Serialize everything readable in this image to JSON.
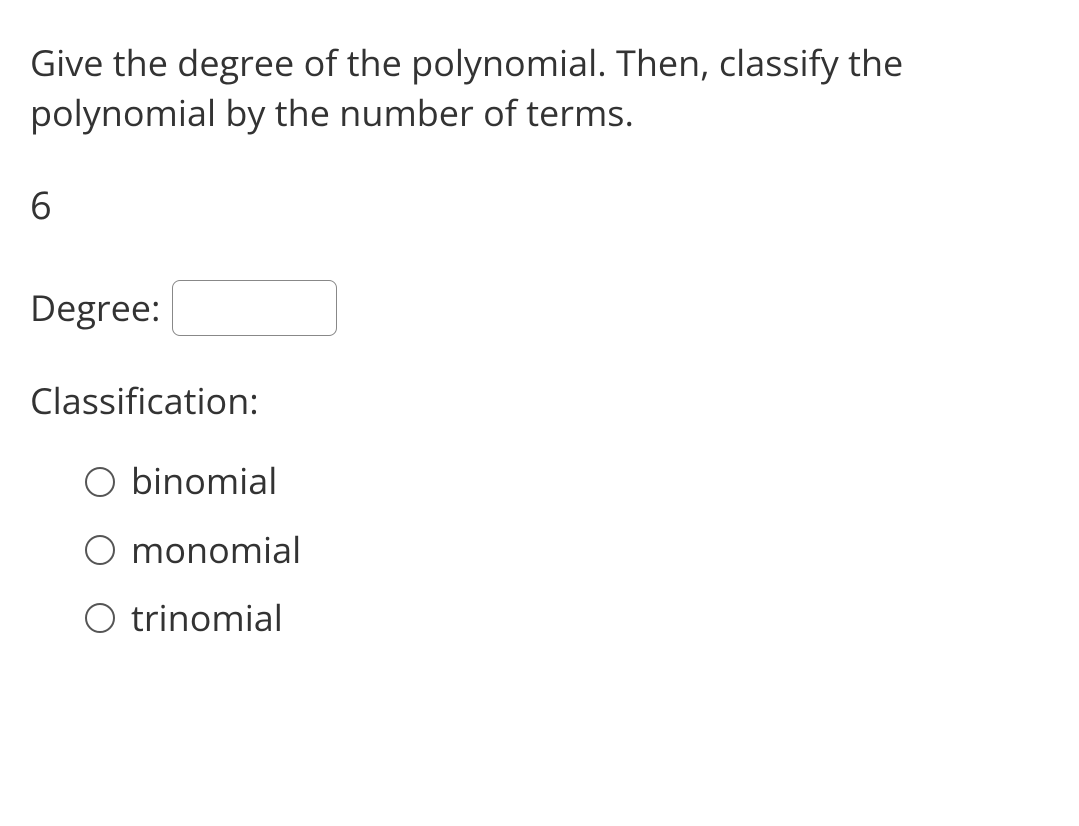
{
  "question": {
    "prompt": "Give the degree of the polynomial.  Then, classify the polynomial by the number of terms.",
    "polynomial": "6"
  },
  "degree": {
    "label": "Degree:",
    "value": ""
  },
  "classification": {
    "label": "Classification:",
    "options": [
      {
        "label": "binomial"
      },
      {
        "label": "monomial"
      },
      {
        "label": "trinomial"
      }
    ]
  }
}
